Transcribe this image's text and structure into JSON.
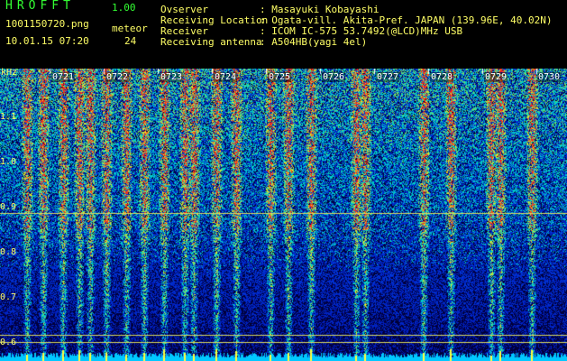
{
  "header": {
    "brand": "HROFFT",
    "version": "1.00",
    "filename": "1001150720.png",
    "datetime": "10.01.15 07:20",
    "meteor_label": "meteor",
    "meteor_count": "24"
  },
  "station": {
    "rows": [
      {
        "label": "Ovserver",
        "value": ": Masayuki Kobayashi"
      },
      {
        "label": "Receiving Location",
        "value": ": Ogata-vill. Akita-Pref. JAPAN (139.96E, 40.02N)"
      },
      {
        "label": "Receiver",
        "value": ": ICOM IC-575 53.7492(@LCD)MHz USB"
      },
      {
        "label": "Receiving antenna",
        "value": ": A504HB(yagi 4el)"
      }
    ]
  },
  "axis": {
    "unit": "kHz",
    "y_ticks": [
      "1.1",
      "1.0",
      "0.9",
      "0.8",
      "0.7",
      "0.6"
    ],
    "time_ticks": [
      "0721",
      "0722",
      "0723",
      "0724",
      "0725",
      "0726",
      "0727",
      "0728",
      "0729",
      "0730"
    ]
  },
  "colors": {
    "label": "#ffff66",
    "brand": "#33ff33",
    "background": "#000000",
    "noise_floor": "#00c8ff"
  }
}
